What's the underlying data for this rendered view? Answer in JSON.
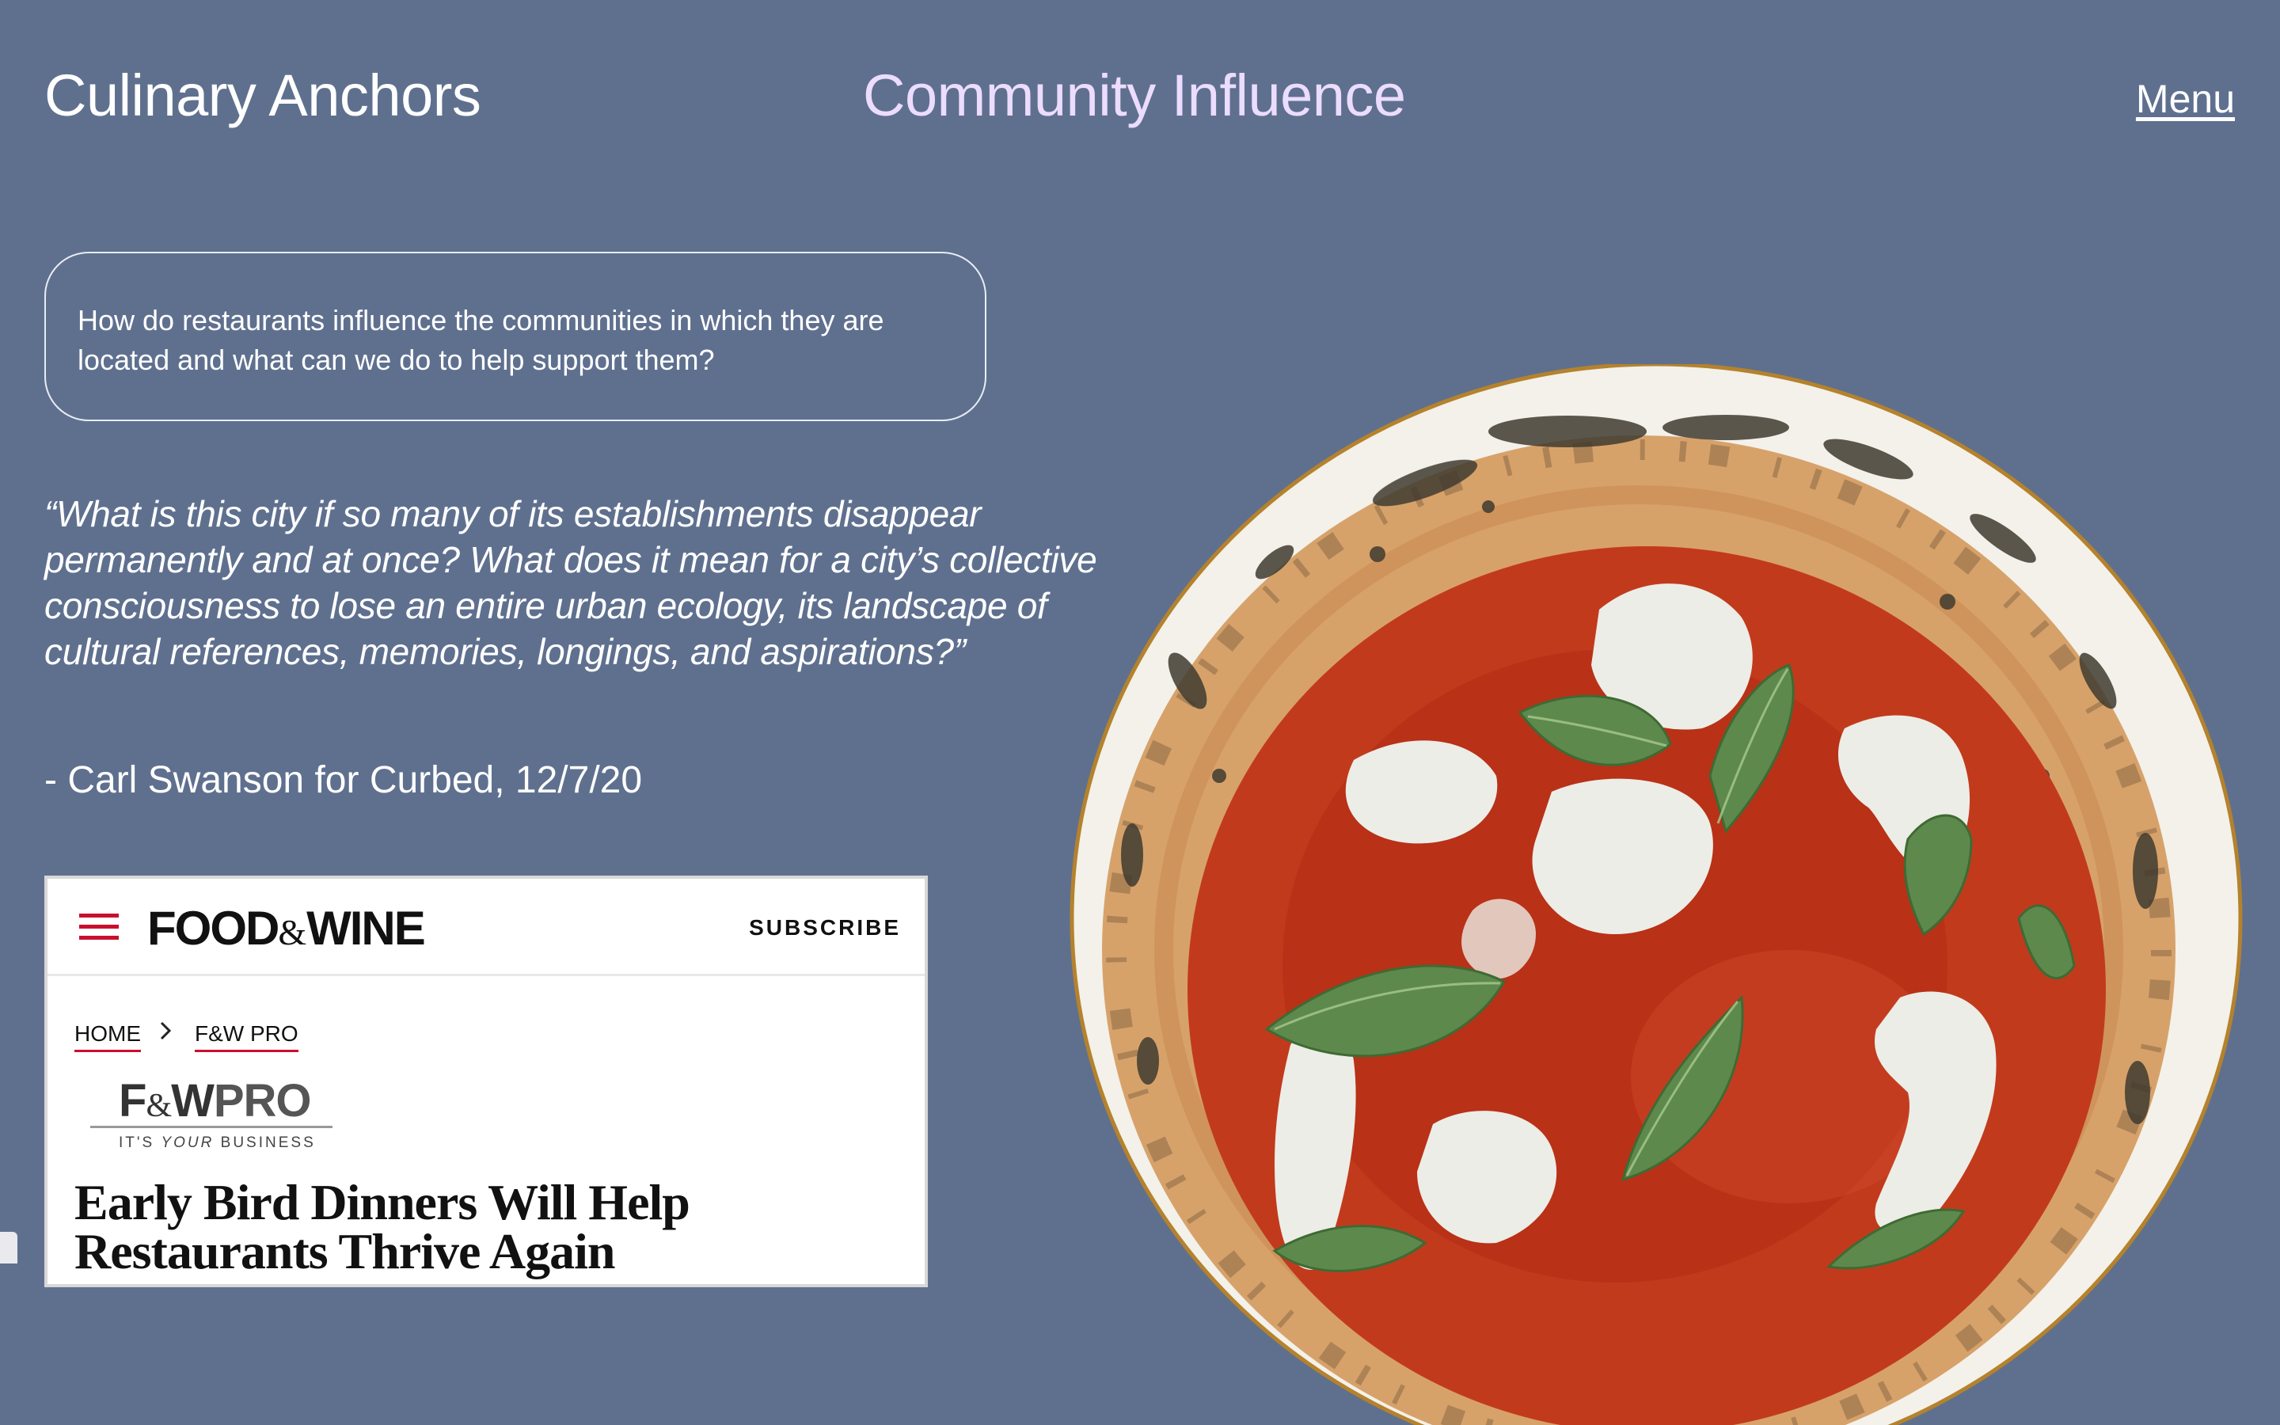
{
  "header": {
    "site_title": "Culinary Anchors",
    "page_title": "Community Influence",
    "menu_label": "Menu"
  },
  "question": "How do restaurants influence the communities in which they are located and what can we do to help support them?",
  "quote": {
    "text": "“What is this city if so many of its establishments disappear permanently and at once? What does it mean for a city’s collective consciousness to lose an entire urban ecology, its landscape of cultural references, memories, longings, and aspirations?”",
    "attribution": "- Carl Swanson for Curbed, 12/7/20"
  },
  "article": {
    "logo": {
      "left": "FOOD",
      "amp": "&",
      "right": "WINE"
    },
    "subscribe_label": "SUBSCRIBE",
    "breadcrumb": {
      "home": "HOME",
      "section": "F&W PRO"
    },
    "pro_logo": {
      "left": "F",
      "amp": "&",
      "mid": "W",
      "pro": "PRO",
      "tagline_a": "IT'S ",
      "tagline_em": "YOUR",
      "tagline_b": " BUSINESS"
    },
    "headline": "Early Bird Dinners Will Help Restaurants Thrive Again"
  },
  "colors": {
    "background": "#5f708f",
    "page_title": "#ecdcff",
    "brand_red": "#c8102e"
  },
  "icons": {
    "hamburger": "hamburger-menu-icon",
    "breadcrumb_separator": "chevron-right-icon",
    "illustration": "margherita-pizza-illustration"
  }
}
